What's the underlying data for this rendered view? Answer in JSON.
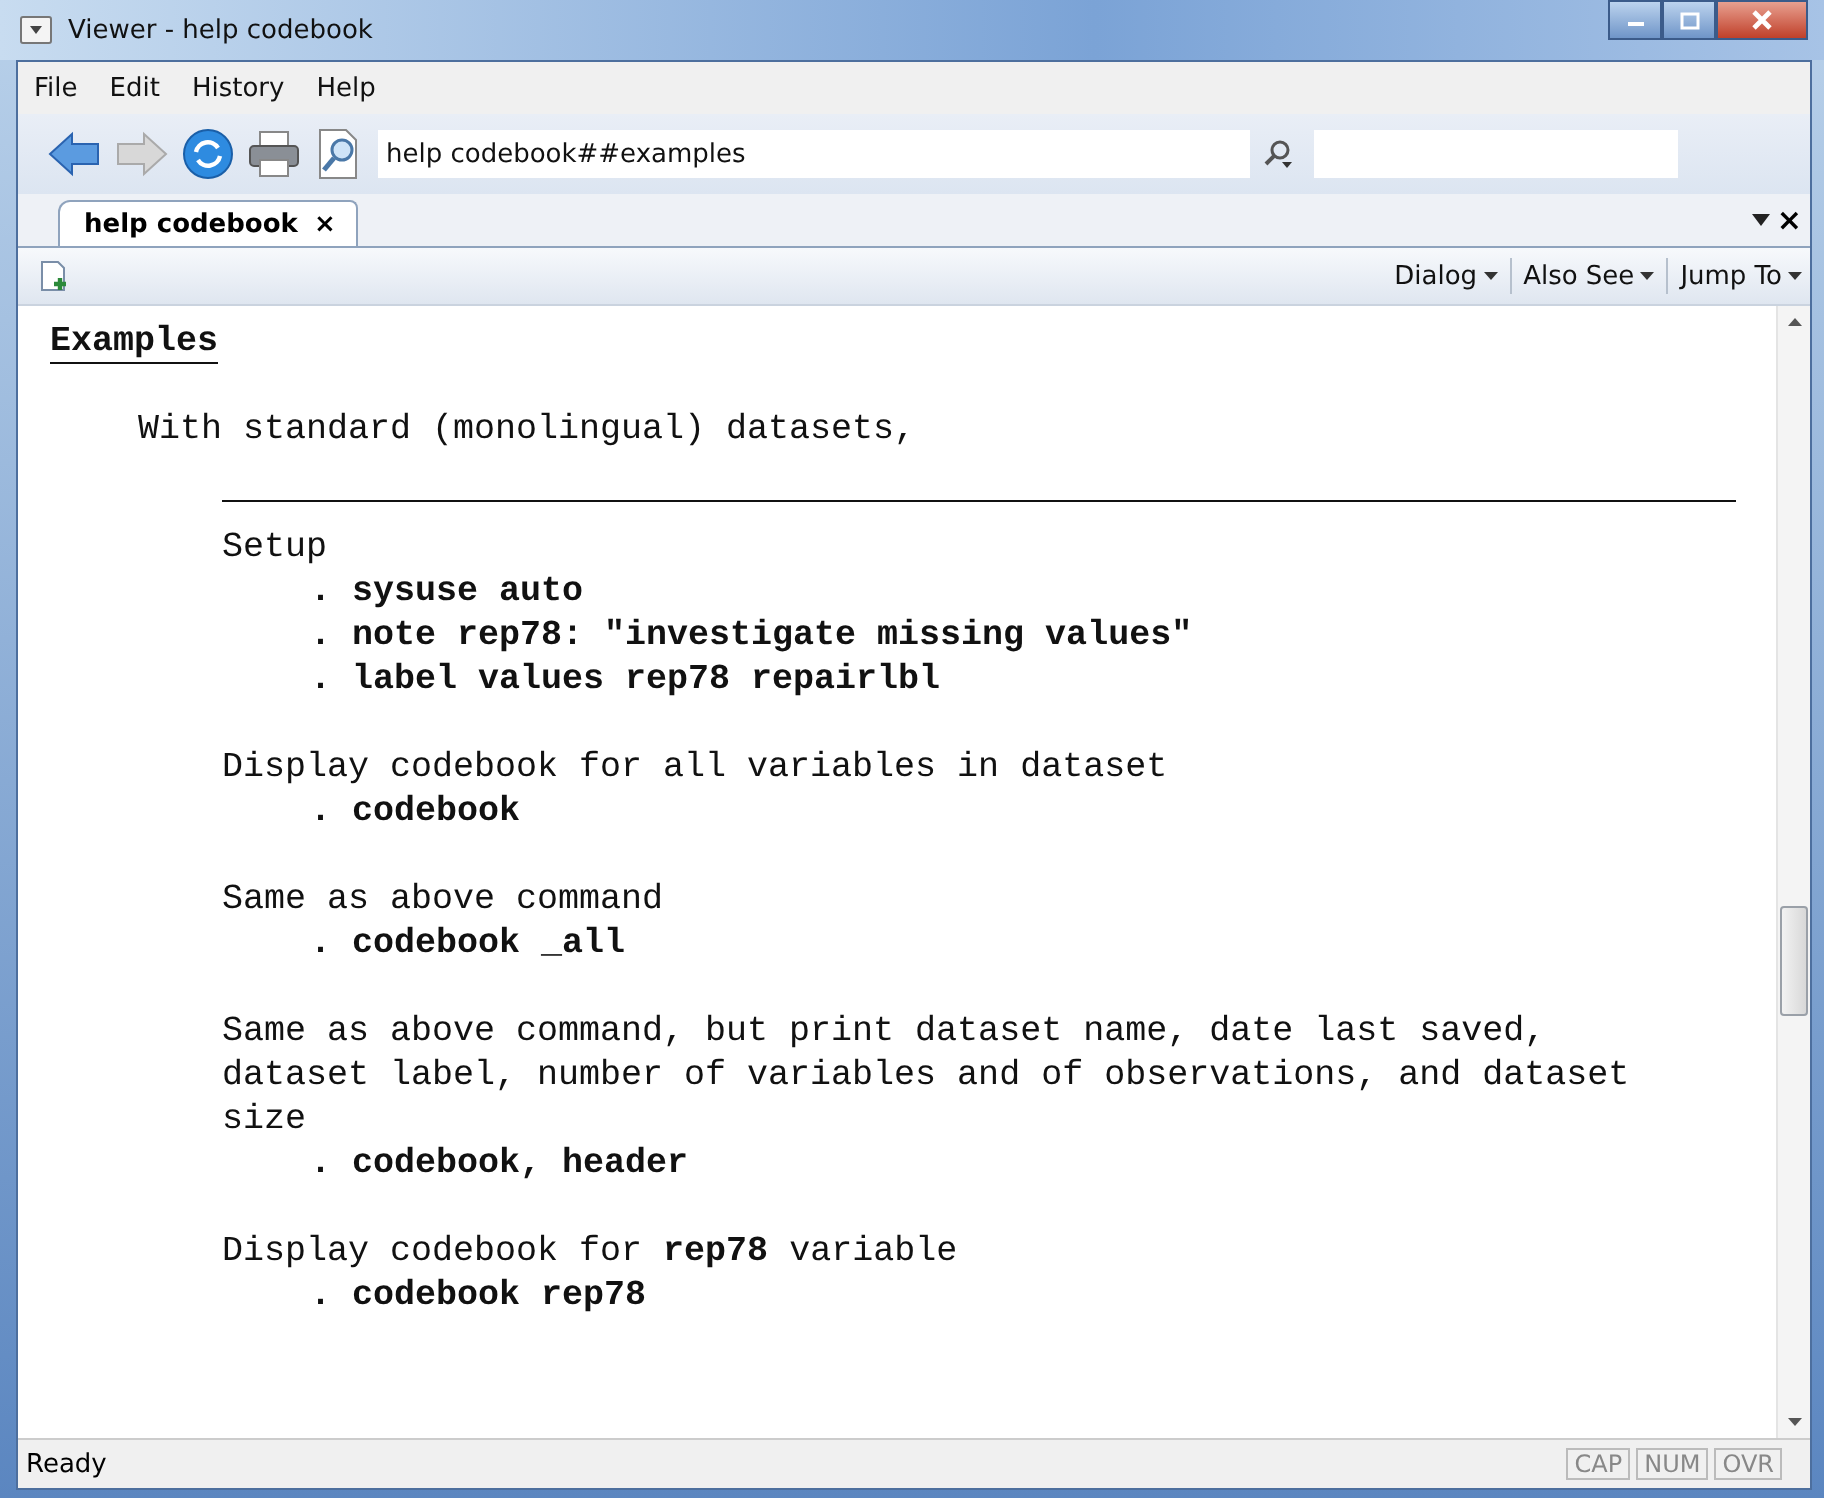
{
  "window": {
    "title": "Viewer - help codebook"
  },
  "menu": [
    "File",
    "Edit",
    "History",
    "Help"
  ],
  "address": {
    "value": "help codebook##examples"
  },
  "tabs": [
    {
      "label": "help codebook",
      "close": "×",
      "selected": true
    }
  ],
  "tab_bar_close": "×",
  "doc_toolbar": [
    "Dialog",
    "Also See",
    "Jump To"
  ],
  "content": {
    "heading": "Examples",
    "intro": "With standard (monolingual) datasets,",
    "sections": [
      {
        "description": "Setup",
        "commands": [
          ". sysuse auto",
          ". note rep78: \"investigate missing values\"",
          ". label values rep78 repairlbl"
        ]
      },
      {
        "description": "Display codebook for all variables in dataset",
        "commands": [
          ". codebook"
        ]
      },
      {
        "description": "Same as above command",
        "commands": [
          ". codebook _all"
        ]
      },
      {
        "description": "Same as above command, but print dataset name, date last saved, dataset label, number of variables and of observations, and dataset size",
        "commands": [
          ". codebook, header"
        ]
      },
      {
        "description": "Display codebook for **rep78** variable",
        "commands": [
          ". codebook rep78"
        ]
      }
    ]
  },
  "status_bar": {
    "text": "Ready",
    "indicators": [
      "CAP",
      "NUM",
      "OVR"
    ]
  }
}
